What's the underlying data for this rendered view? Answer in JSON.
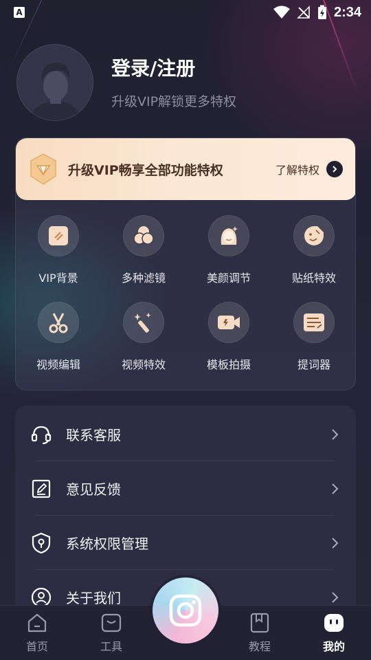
{
  "status_bar": {
    "time": "2:34",
    "app_badge": "A"
  },
  "profile": {
    "title": "登录/注册",
    "subtitle": "升级VIP解锁更多特权"
  },
  "vip": {
    "banner_text": "升级VIP畅享全部功能特权",
    "learn_more": "了解特权"
  },
  "features": [
    {
      "label": "VIP背景",
      "icon": "vip-background-icon"
    },
    {
      "label": "多种滤镜",
      "icon": "filters-icon"
    },
    {
      "label": "美颜调节",
      "icon": "beauty-icon"
    },
    {
      "label": "贴纸特效",
      "icon": "sticker-icon"
    },
    {
      "label": "视频编辑",
      "icon": "scissors-icon"
    },
    {
      "label": "视频特效",
      "icon": "magic-wand-icon"
    },
    {
      "label": "模板拍摄",
      "icon": "video-camera-icon"
    },
    {
      "label": "提词器",
      "icon": "teleprompter-icon"
    }
  ],
  "menu": [
    {
      "label": "联系客服",
      "icon": "headset-icon"
    },
    {
      "label": "意见反馈",
      "icon": "feedback-icon"
    },
    {
      "label": "系统权限管理",
      "icon": "shield-icon"
    },
    {
      "label": "关于我们",
      "icon": "about-icon"
    }
  ],
  "nav": {
    "home": "首页",
    "tools": "工具",
    "tutorial": "教程",
    "mine": "我的",
    "active": "mine"
  },
  "colors": {
    "vip_banner": "#f8dcc0",
    "vip_text": "#4a3022",
    "background": "#1c1c2e",
    "menu_bg": "#2c2c42"
  }
}
